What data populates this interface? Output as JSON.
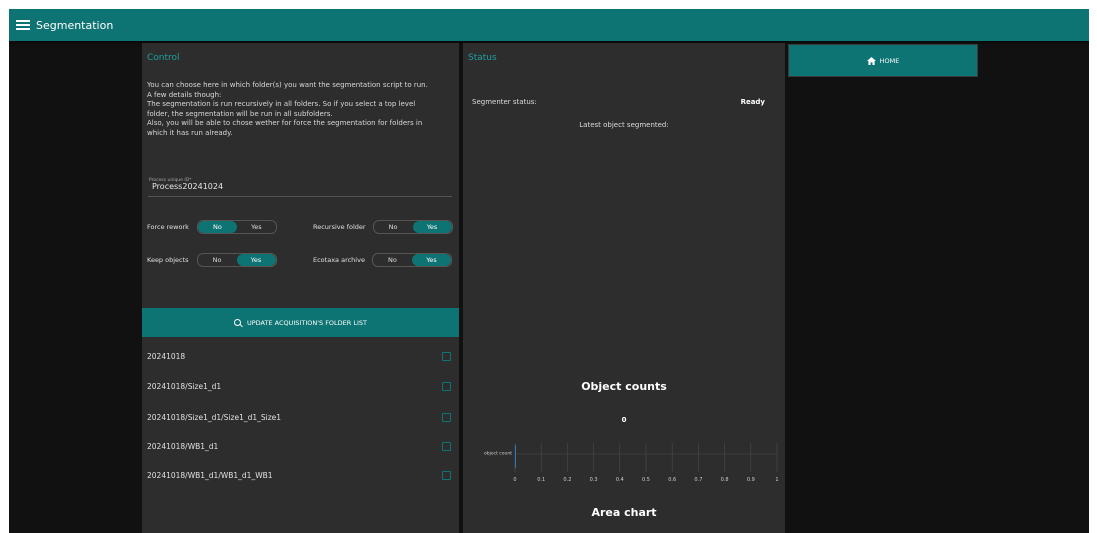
{
  "header": {
    "title": "Segmentation",
    "menu_icon": "menu-icon"
  },
  "control": {
    "title": "Control",
    "description": [
      "You can choose here in which folder(s) you want the segmentation script to run.",
      "A few details though:",
      "The segmentation is run recursively in all folders. So if you select a top level",
      "folder, the segmentation will be run in all subfolders.",
      "Also, you will be able to chose wether for force the segmentation for folders in",
      "which it has run already."
    ],
    "process_id": {
      "label": "Process unique ID*",
      "value": "Process20241024"
    },
    "toggles": {
      "force_rework": {
        "label": "Force rework",
        "options": [
          "No",
          "Yes"
        ],
        "selected": "No"
      },
      "recursive_folder": {
        "label": "Recursive folder",
        "options": [
          "No",
          "Yes"
        ],
        "selected": "Yes"
      },
      "keep_objects": {
        "label": "Keep objects",
        "options": [
          "No",
          "Yes"
        ],
        "selected": "Yes"
      },
      "ecotaxa_archive": {
        "label": "Ecotaxa archive",
        "options": [
          "No",
          "Yes"
        ],
        "selected": "Yes"
      }
    },
    "update_button": {
      "label": "UPDATE ACQUISITION'S FOLDER LIST",
      "icon": "search-icon"
    },
    "folders": [
      {
        "name": "20241018",
        "checked": false
      },
      {
        "name": "20241018/Size1_d1",
        "checked": false
      },
      {
        "name": "20241018/Size1_d1/Size1_d1_Size1",
        "checked": false
      },
      {
        "name": "20241018/WB1_d1",
        "checked": false
      },
      {
        "name": "20241018/WB1_d1/WB1_d1_WB1",
        "checked": false
      }
    ]
  },
  "status": {
    "title": "Status",
    "segmenter_status_label": "Segmenter status:",
    "segmenter_status_value": "Ready",
    "latest_object_label": "Latest object segmented:",
    "object_counts_title": "Object counts",
    "object_counts_value": "0",
    "area_chart_title": "Area chart"
  },
  "home_button": {
    "label": "HOME",
    "icon": "home-icon"
  },
  "colors": {
    "accent": "#0e7373",
    "panel": "#2d2d2d",
    "background": "#111111"
  },
  "chart_data": {
    "type": "bar",
    "categories": [
      "object count"
    ],
    "values": [
      0
    ],
    "xlim": [
      0,
      1
    ],
    "xticks": [
      "0",
      "0.1",
      "0.2",
      "0.3",
      "0.4",
      "0.5",
      "0.6",
      "0.7",
      "0.8",
      "0.9",
      "1"
    ],
    "grid": true,
    "orientation": "horizontal"
  }
}
